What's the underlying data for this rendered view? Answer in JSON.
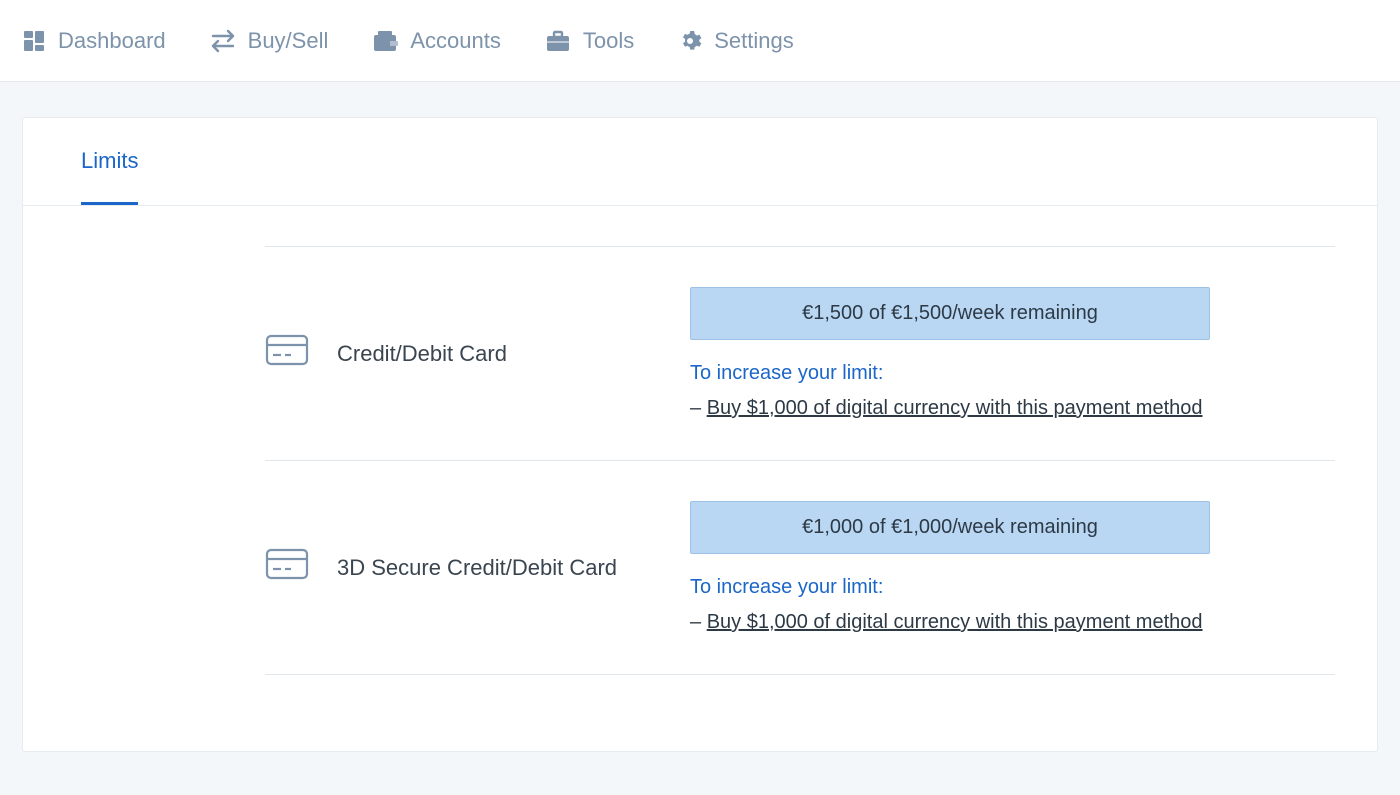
{
  "nav": {
    "dashboard": "Dashboard",
    "buy_sell": "Buy/Sell",
    "accounts": "Accounts",
    "tools": "Tools",
    "settings": "Settings"
  },
  "tabs": {
    "limits": "Limits"
  },
  "icons": {
    "dashboard": "dashboard-icon",
    "buy_sell": "swap-icon",
    "accounts": "wallet-icon",
    "tools": "briefcase-icon",
    "settings": "gear-icon",
    "card": "credit-card-icon"
  },
  "limits": [
    {
      "method_label": "Credit/Debit Card",
      "remaining_text": "€1,500 of €1,500/week remaining",
      "increase_heading": "To increase your limit:",
      "dash": "– ",
      "action_text": "Buy $1,000 of digital currency with this payment method"
    },
    {
      "method_label": "3D Secure Credit/Debit Card",
      "remaining_text": "€1,000 of €1,000/week remaining",
      "increase_heading": "To increase your limit:",
      "dash": "– ",
      "action_text": "Buy $1,000 of digital currency with this payment method"
    }
  ]
}
